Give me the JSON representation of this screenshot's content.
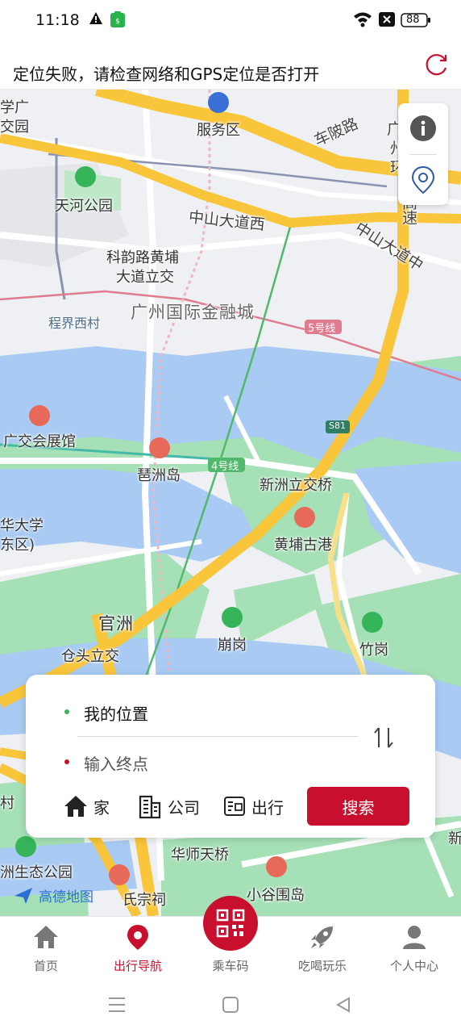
{
  "status_bar": {
    "time": "11:18",
    "battery": "88"
  },
  "banner": {
    "message": "定位失败，请检查网络和GPS定位是否打开"
  },
  "map": {
    "labels": {
      "school_a": "学广",
      "school_b": "交园",
      "service_area": "服务区",
      "chebei_road": "车陂路",
      "guang_a": "广",
      "guang_b": "州",
      "guang_c": "环",
      "expressway": "高速",
      "zhongshan_west": "中山大道西",
      "zhongshan_mid": "中山大道中",
      "tianhe_park": "天河公园",
      "keyun_a": "科韵路黄埔",
      "keyun_b": "大道立交",
      "chengjie": "程界西村",
      "ifc": "广州国际金融城",
      "line5": "5号线",
      "s81": "S81",
      "expo": "广交会展馆",
      "pazhou": "琶洲岛",
      "line4": "4号线",
      "xinzhou_bridge": "新洲立交桥",
      "univ_a": "华大学",
      "univ_b": "东区)",
      "huangpu_port": "黄埔古港",
      "guanzhou": "官洲",
      "cangtou": "仓头立交",
      "benggang": "崩岗",
      "zhugang": "竹岗",
      "cun": "村",
      "huashi_bridge": "华师天桥",
      "eco_park": "洲生态公园",
      "xiaoguwei": "小谷围岛",
      "xinjiao": "新",
      "ancestral": "氏宗祠",
      "amap": "高德地图"
    }
  },
  "search_card": {
    "origin": "我的位置",
    "destination_placeholder": "输入终点",
    "shortcuts": {
      "home": "家",
      "company": "公司",
      "travel": "出行"
    },
    "search_button": "搜索"
  },
  "tabbar": {
    "items": [
      {
        "label": "首页",
        "icon": "home-icon"
      },
      {
        "label": "出行导航",
        "icon": "location-pin-icon",
        "active": true
      },
      {
        "label": "乘车码",
        "icon": "qr-code-icon"
      },
      {
        "label": "吃喝玩乐",
        "icon": "rocket-icon"
      },
      {
        "label": "个人中心",
        "icon": "user-icon"
      }
    ]
  },
  "colors": {
    "accent": "#c8102e",
    "water": "#a9cbf3",
    "green": "#a6e0b7",
    "expressway": "#f9c53a"
  }
}
